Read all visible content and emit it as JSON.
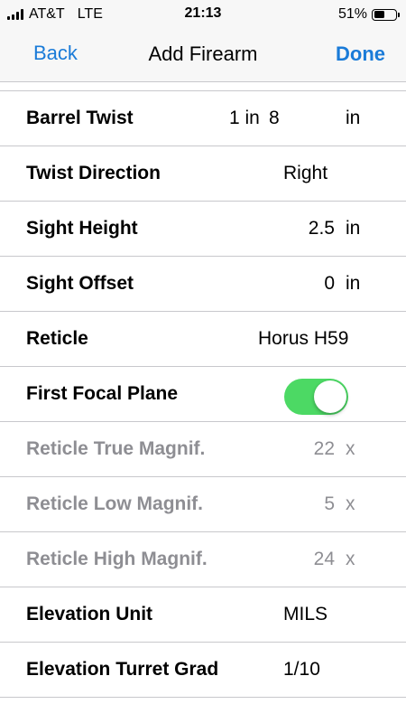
{
  "status_bar": {
    "carrier": "AT&T",
    "network": "LTE",
    "time": "21:13",
    "battery_percent": "51%",
    "battery_level": 0.51
  },
  "nav": {
    "back_label": "Back",
    "title": "Add Firearm",
    "done_label": "Done"
  },
  "rows": {
    "barrel_twist": {
      "label": "Barrel Twist",
      "prefix": "1 in",
      "value": "8",
      "unit": "in"
    },
    "twist_direction": {
      "label": "Twist Direction",
      "value": "Right"
    },
    "sight_height": {
      "label": "Sight Height",
      "value": "2.5",
      "unit": "in"
    },
    "sight_offset": {
      "label": "Sight Offset",
      "value": "0",
      "unit": "in"
    },
    "reticle": {
      "label": "Reticle",
      "value": "Horus H59"
    },
    "first_focal_plane": {
      "label": "First Focal Plane",
      "enabled": true,
      "toggle_color": "#4cd964"
    },
    "reticle_true_magnif": {
      "label": "Reticle True Magnif.",
      "value": "22",
      "unit": "x"
    },
    "reticle_low_magnif": {
      "label": "Reticle Low Magnif.",
      "value": "5",
      "unit": "x"
    },
    "reticle_high_magnif": {
      "label": "Reticle High Magnif.",
      "value": "24",
      "unit": "x"
    },
    "elevation_unit": {
      "label": "Elevation Unit",
      "value": "MILS"
    },
    "elevation_turret_grad": {
      "label": "Elevation Turret Grad",
      "value": "1/10"
    }
  },
  "colors": {
    "accent": "#1a7bd8",
    "disabled_text": "#8e8e93",
    "separator": "#c8c8cc"
  }
}
